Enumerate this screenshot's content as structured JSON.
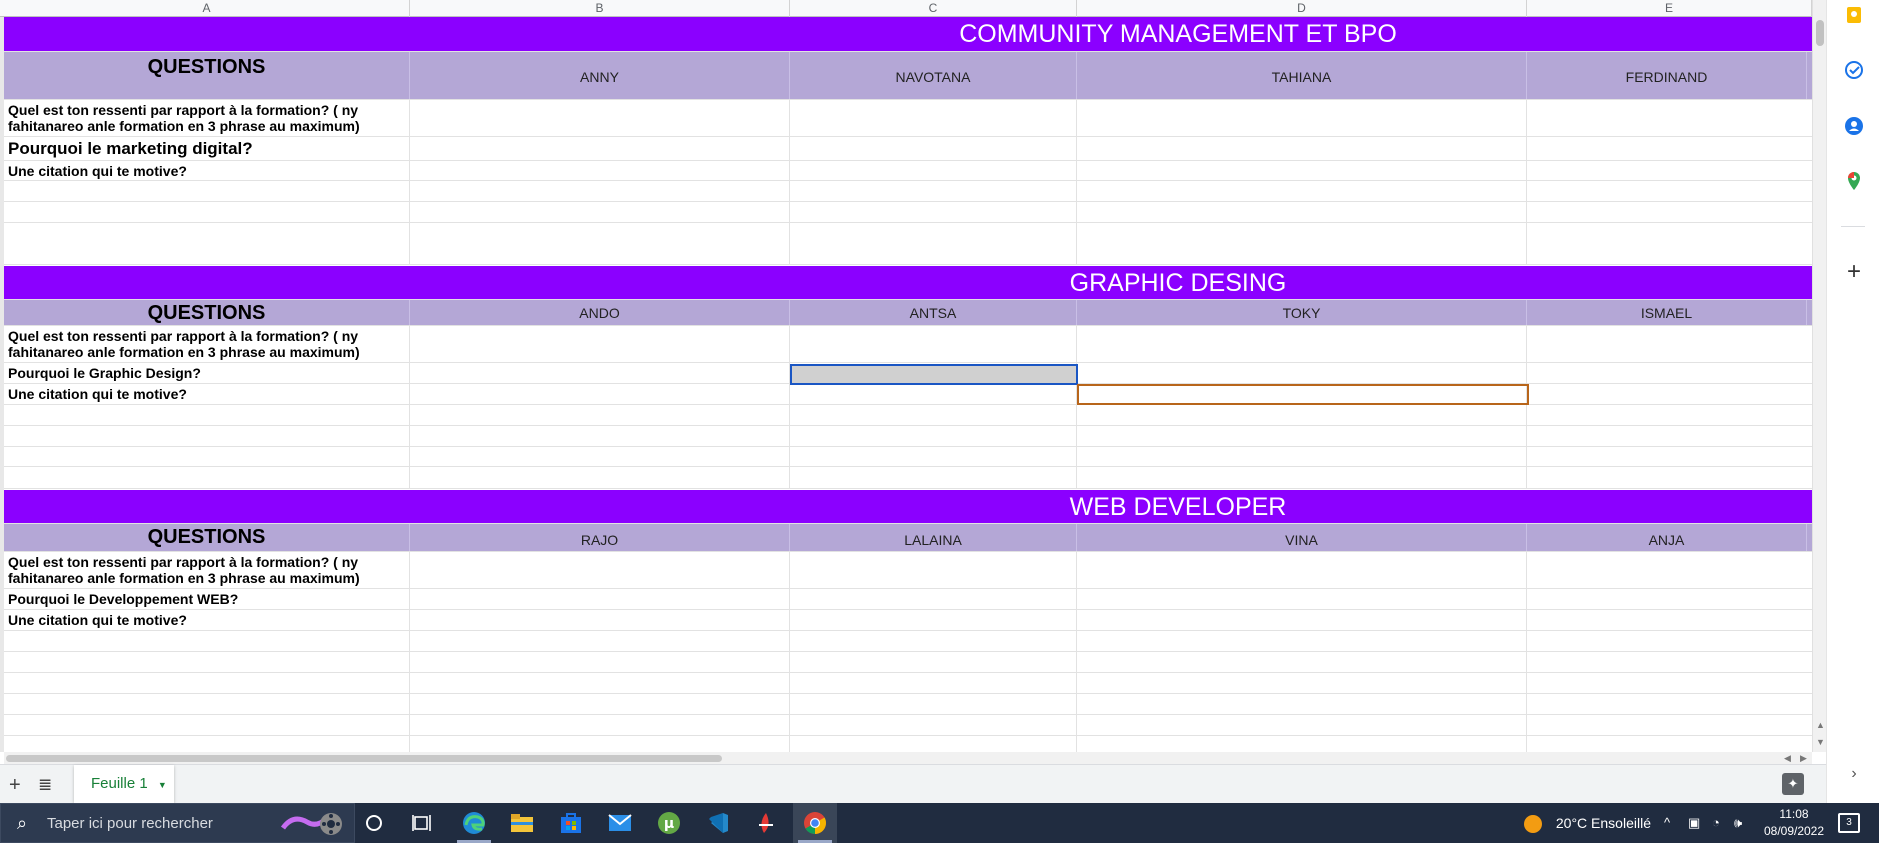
{
  "columns": [
    "A",
    "B",
    "C",
    "D",
    "E"
  ],
  "sections": [
    {
      "title": "COMMUNITY MANAGEMENT ET BPO",
      "questions_label": "QUESTIONS",
      "names": [
        "ANNY",
        "NAVOTANA",
        "TAHIANA",
        "FERDINAND"
      ],
      "questions": [
        "Quel est ton ressenti par rapport à la formation? ( ny fahitanareo anle formation en 3 phrase au maximum)",
        "Pourquoi le marketing digital?",
        "Une citation qui te motive?"
      ]
    },
    {
      "title": "GRAPHIC DESING",
      "questions_label": "QUESTIONS",
      "names": [
        "ANDO",
        "ANTSA",
        "TOKY",
        "ISMAEL"
      ],
      "questions": [
        "Quel est ton ressenti par rapport à la formation? ( ny fahitanareo anle formation en 3 phrase au maximum)",
        "Pourquoi le Graphic Design?",
        "Une citation qui te motive?"
      ]
    },
    {
      "title": "WEB DEVELOPER",
      "questions_label": "QUESTIONS",
      "names": [
        "RAJO",
        "LALAINA",
        "VINA",
        "ANJA"
      ],
      "questions": [
        "Quel est ton ressenti par rapport à la formation? ( ny fahitanareo anle formation en 3 phrase au maximum)",
        "Pourquoi le Developpement WEB?",
        "Une citation qui te motive?"
      ]
    }
  ],
  "sheet_tab": {
    "name": "Feuille 1"
  },
  "colors": {
    "banner": "#8b00ff",
    "header_row": "#b4a7d6",
    "tab_active": "#188038"
  },
  "taskbar": {
    "search_placeholder": "Taper ici pour rechercher",
    "weather": "20°C  Ensoleillé",
    "time": "11:08",
    "date": "08/09/2022",
    "notifications": "3"
  }
}
